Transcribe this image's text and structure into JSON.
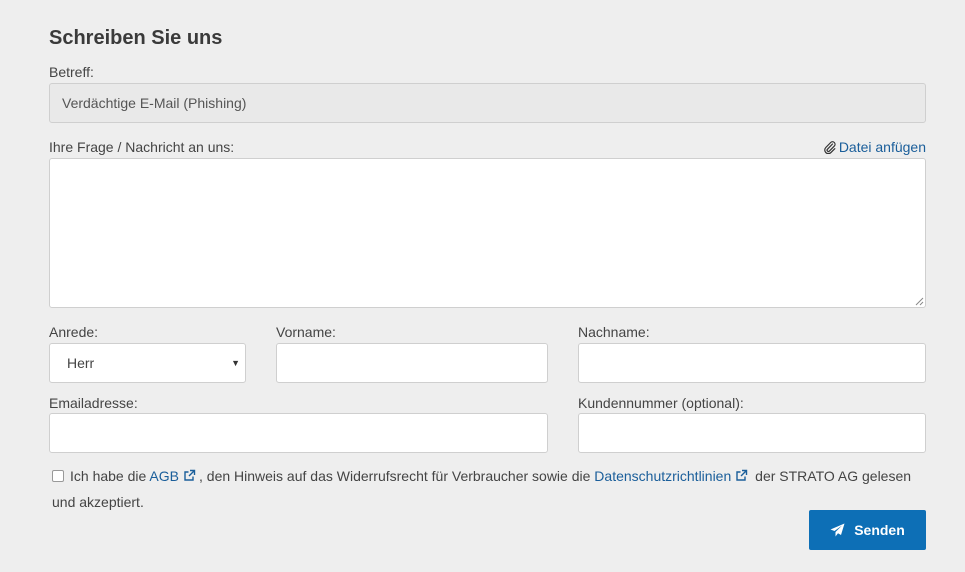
{
  "form": {
    "heading": "Schreiben Sie uns",
    "subject_label": "Betreff:",
    "subject_value": "Verdächtige E-Mail  (Phishing)",
    "message_label": "Ihre Frage / Nachricht an uns:",
    "attach_label": "Datei anfügen",
    "salutation_label": "Anrede:",
    "salutation_value": "Herr",
    "firstname_label": "Vorname:",
    "lastname_label": "Nachname:",
    "email_label": "Emailadresse:",
    "customer_number_label": "Kundennummer (optional):",
    "consent": {
      "text_before": "Ich habe die",
      "agb_link": "AGB",
      "text_middle": ", den Hinweis auf das Widerrufsrecht für Verbraucher sowie die",
      "privacy_link": "Datenschutzrichtlinien",
      "text_after": "der STRATO AG gelesen und akzeptiert."
    },
    "send_label": "Senden"
  },
  "colors": {
    "accent": "#0d6fb6",
    "link": "#1a5e9a",
    "background": "#eeeeee"
  },
  "icons": [
    "paperclip-icon",
    "external-link-icon",
    "paper-plane-icon",
    "chevron-down-icon"
  ]
}
